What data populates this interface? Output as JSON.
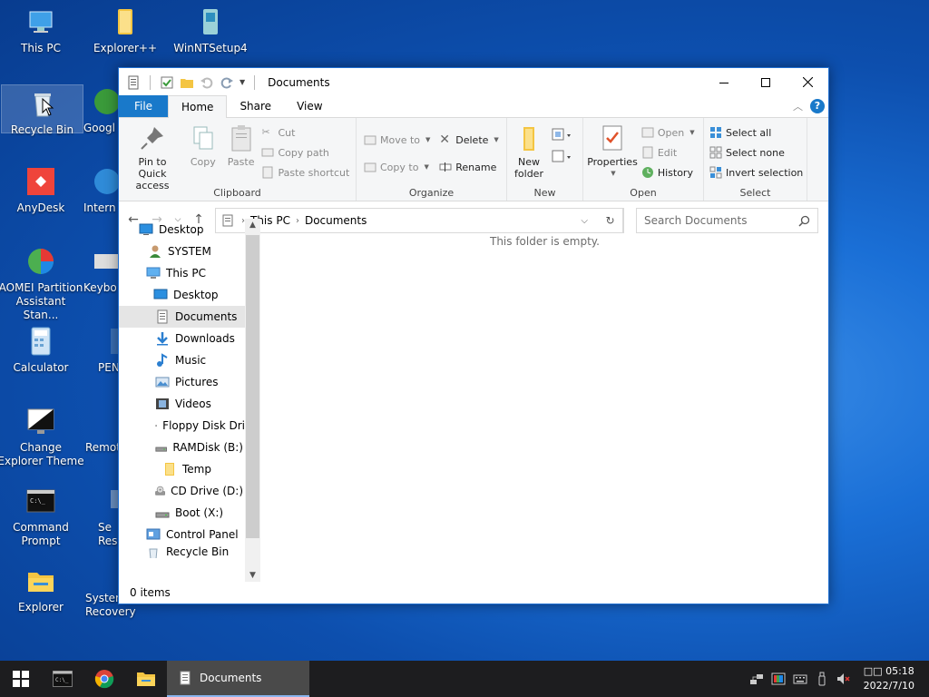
{
  "desktop": {
    "icons": [
      {
        "label": "This PC"
      },
      {
        "label": "Explorer++"
      },
      {
        "label": "WinNTSetup4"
      },
      {
        "label": "Recycle Bin"
      },
      {
        "label": "Googl"
      },
      {
        "label": "AnyDesk"
      },
      {
        "label": "Intern"
      },
      {
        "label": "AOMEI Partition Assistant Stan..."
      },
      {
        "label": "Keybo"
      },
      {
        "label": "Calculator"
      },
      {
        "label": "PEN"
      },
      {
        "label": "Change Explorer Theme"
      },
      {
        "label": "Remot"
      },
      {
        "label": "Command Prompt"
      },
      {
        "label": "Se Res"
      },
      {
        "label": "Explorer"
      },
      {
        "label": "System Recovery"
      }
    ]
  },
  "window": {
    "title": "Documents",
    "tabs": {
      "file": "File",
      "home": "Home",
      "share": "Share",
      "view": "View"
    },
    "ribbon": {
      "clipboard": {
        "label": "Clipboard",
        "pin": "Pin to Quick access",
        "copy": "Copy",
        "paste": "Paste",
        "cut": "Cut",
        "copy_path": "Copy path",
        "paste_shortcut": "Paste shortcut"
      },
      "organize": {
        "label": "Organize",
        "move_to": "Move to",
        "copy_to": "Copy to",
        "delete": "Delete",
        "rename": "Rename"
      },
      "new": {
        "label": "New",
        "new_folder": "New folder"
      },
      "open": {
        "label": "Open",
        "properties": "Properties",
        "open": "Open",
        "edit": "Edit",
        "history": "History"
      },
      "select": {
        "label": "Select",
        "select_all": "Select all",
        "select_none": "Select none",
        "invert": "Invert selection"
      }
    },
    "address": {
      "crumbs": [
        "This PC",
        "Documents"
      ],
      "search_placeholder": "Search Documents"
    },
    "nav": [
      {
        "label": "Desktop",
        "icon": "desktop-icon"
      },
      {
        "label": "SYSTEM",
        "icon": "user-icon"
      },
      {
        "label": "This PC",
        "icon": "computer-icon"
      },
      {
        "label": "Desktop",
        "icon": "desktop-icon"
      },
      {
        "label": "Documents",
        "icon": "documents-icon"
      },
      {
        "label": "Downloads",
        "icon": "downloads-icon"
      },
      {
        "label": "Music",
        "icon": "music-icon"
      },
      {
        "label": "Pictures",
        "icon": "pictures-icon"
      },
      {
        "label": "Videos",
        "icon": "videos-icon"
      },
      {
        "label": "Floppy Disk Dri",
        "icon": "floppy-icon"
      },
      {
        "label": "RAMDisk (B:)",
        "icon": "drive-icon"
      },
      {
        "label": "Temp",
        "icon": "folder-icon"
      },
      {
        "label": "CD Drive (D:)",
        "icon": "cd-drive-icon"
      },
      {
        "label": "Boot (X:)",
        "icon": "drive-icon"
      },
      {
        "label": "Control Panel",
        "icon": "control-panel-icon"
      },
      {
        "label": "Recycle Bin",
        "icon": "recycle-bin-icon"
      }
    ],
    "empty_message": "This folder is empty.",
    "status": "0 items"
  },
  "taskbar": {
    "active_task": "Documents",
    "time": "□□ 05:18",
    "date": "2022/7/10"
  },
  "colors": {
    "accent": "#1979ca",
    "taskbar": "#1d1d1f"
  }
}
